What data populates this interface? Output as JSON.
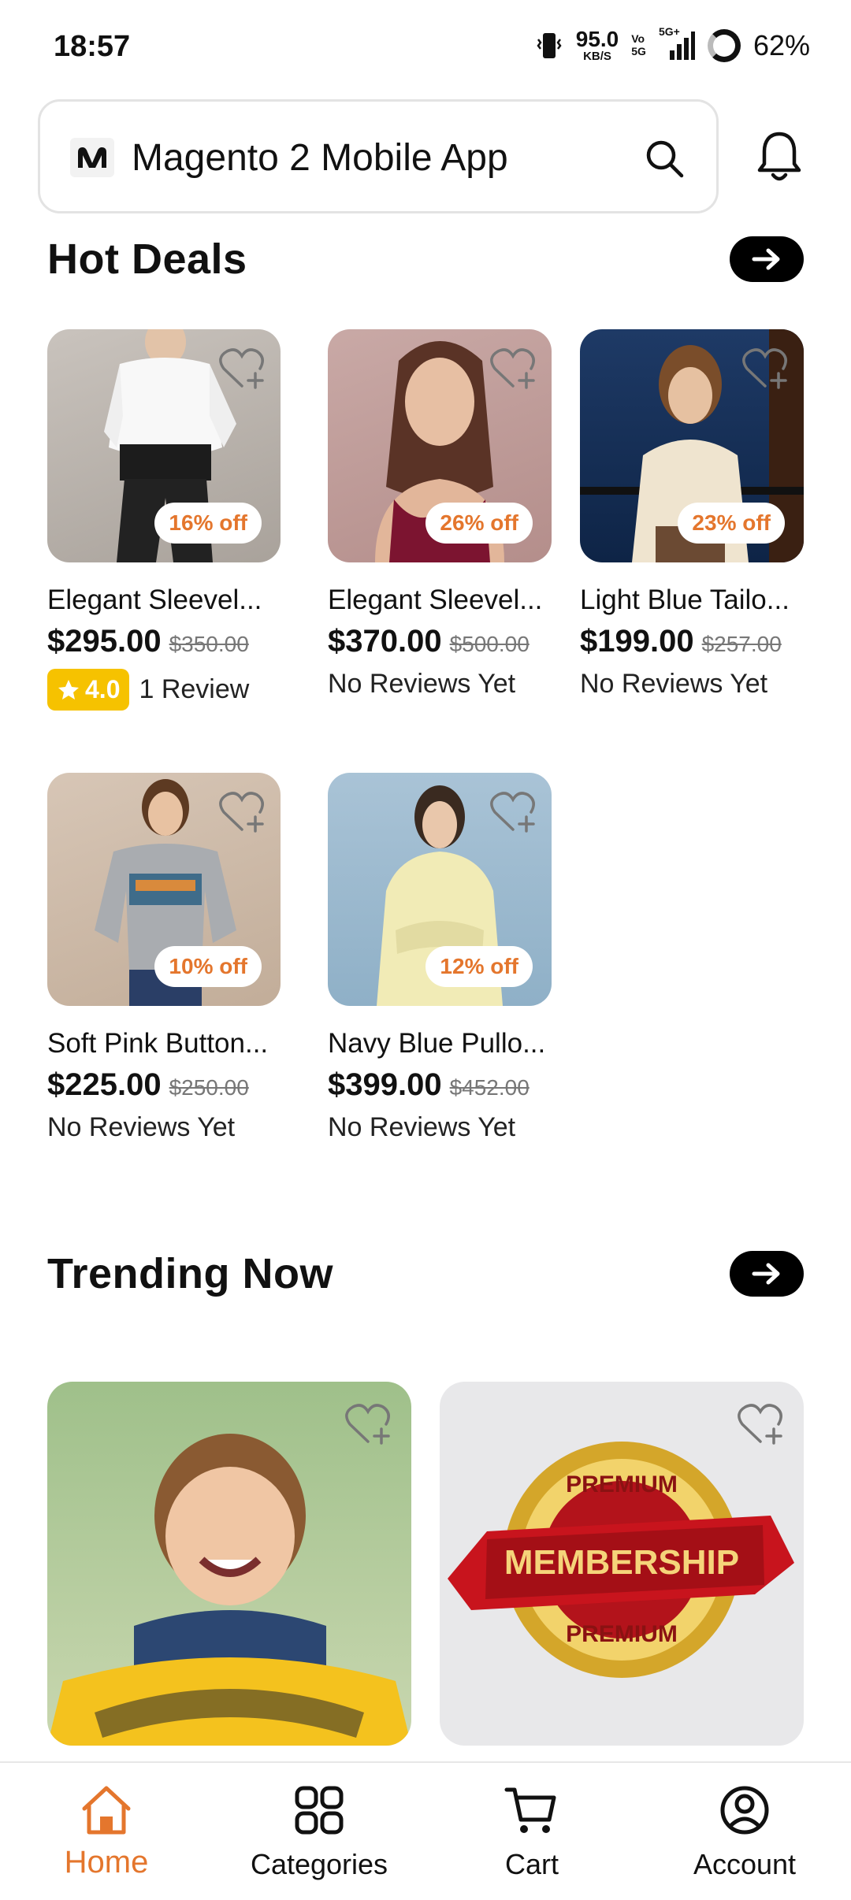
{
  "status_bar": {
    "time": "18:57",
    "net_speed": "95.0",
    "net_unit": "KB/S",
    "vo_tag": "Vo",
    "vo_sub": "5G",
    "net_type": "5G+",
    "battery": "62%"
  },
  "header": {
    "title": "Magento 2 Mobile App",
    "search_icon": "search-icon",
    "bell_icon": "bell-icon"
  },
  "hot_deals": {
    "title": "Hot Deals",
    "products": [
      {
        "name": "Elegant Sleevel...",
        "price": "$295.00",
        "old_price": "$350.00",
        "discount": "16% off",
        "rating": "4.0",
        "reviews": "1 Review"
      },
      {
        "name": "Elegant Sleevel...",
        "price": "$370.00",
        "old_price": "$500.00",
        "discount": "26% off",
        "reviews": "No Reviews Yet"
      },
      {
        "name": "Light Blue Tailo...",
        "price": "$199.00",
        "old_price": "$257.00",
        "discount": "23% off",
        "reviews": "No Reviews Yet"
      },
      {
        "name": "Soft Pink Button...",
        "price": "$225.00",
        "old_price": "$250.00",
        "discount": "10% off",
        "reviews": "No Reviews Yet"
      },
      {
        "name": "Navy Blue Pullo...",
        "price": "$399.00",
        "old_price": "$452.00",
        "discount": "12% off",
        "reviews": "No Reviews Yet"
      }
    ]
  },
  "trending": {
    "title": "Trending Now",
    "membership_text": "MEMBERSHIP",
    "premium_text": "PREMIUM"
  },
  "bottom_nav": {
    "items": [
      {
        "label": "Home",
        "icon": "home-icon",
        "active": true
      },
      {
        "label": "Categories",
        "icon": "categories-icon"
      },
      {
        "label": "Cart",
        "icon": "cart-icon"
      },
      {
        "label": "Account",
        "icon": "account-icon"
      }
    ]
  },
  "colors": {
    "accent": "#e4762d",
    "rating": "#f6c200",
    "text": "#111111"
  }
}
